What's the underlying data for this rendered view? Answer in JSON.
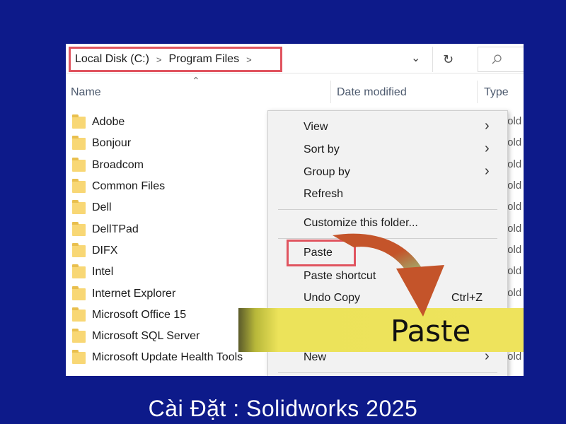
{
  "address_bar": {
    "crumbs": [
      "Local Disk (C:)",
      "Program Files"
    ],
    "separator": ">",
    "dropdown_icon": "chevron-down-icon",
    "refresh_icon": "refresh-icon",
    "search_icon": "search-icon"
  },
  "columns": {
    "name": "Name",
    "date_modified": "Date modified",
    "type": "Type"
  },
  "files": [
    "Adobe",
    "Bonjour",
    "Broadcom",
    "Common Files",
    "Dell",
    "DellTPad",
    "DIFX",
    "Intel",
    "Internet Explorer",
    "Microsoft Office 15",
    "Microsoft SQL Server",
    "Microsoft Update Health Tools"
  ],
  "type_fragment": "fold",
  "context_menu": {
    "view": "View",
    "sort_by": "Sort by",
    "group_by": "Group by",
    "refresh": "Refresh",
    "customize": "Customize this folder...",
    "paste": "Paste",
    "paste_shortcut": "Paste shortcut",
    "undo_copy": "Undo Copy",
    "undo_shortcut": "Ctrl+Z",
    "new": "New"
  },
  "banner": {
    "text": "Paste"
  },
  "caption": "Cài Đặt : Solidworks 2025",
  "colors": {
    "background": "#0d1a8a",
    "highlight_box": "#e0545f",
    "banner_yellow": "#eee35c",
    "arrow_orange": "#c4542a",
    "arrow_green": "#8fd48a"
  }
}
